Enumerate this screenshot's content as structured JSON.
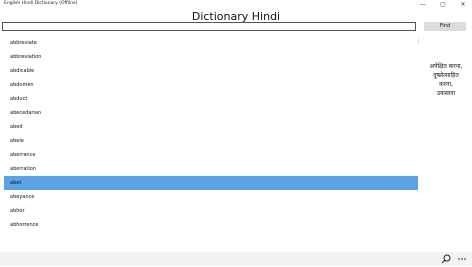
{
  "window": {
    "title": "English Hindi Dictionary (Offline)",
    "minimize": "—",
    "maximize": "▢",
    "close": "✕"
  },
  "header": {
    "title": "Dictionary Hindi"
  },
  "search": {
    "value": "",
    "placeholder": "",
    "button_label": "Find"
  },
  "list": {
    "items": [
      "abbreviate",
      "abbreviation",
      "abdicable",
      "abdomen",
      "abduct",
      "abecedarian",
      "abed",
      "abele",
      "aberrance",
      "aberration",
      "abet",
      "abeyance",
      "abhor",
      "abhorrence"
    ],
    "selected": "abet",
    "more_icon": "⋮"
  },
  "meaning": {
    "lines": [
      "अपेक्षित करना,",
      "दुष्प्रोत्साहित",
      "करना,",
      "उकसाना"
    ]
  },
  "bottombar": {
    "search_icon": "search-icon",
    "more_icon": "more-icon"
  }
}
